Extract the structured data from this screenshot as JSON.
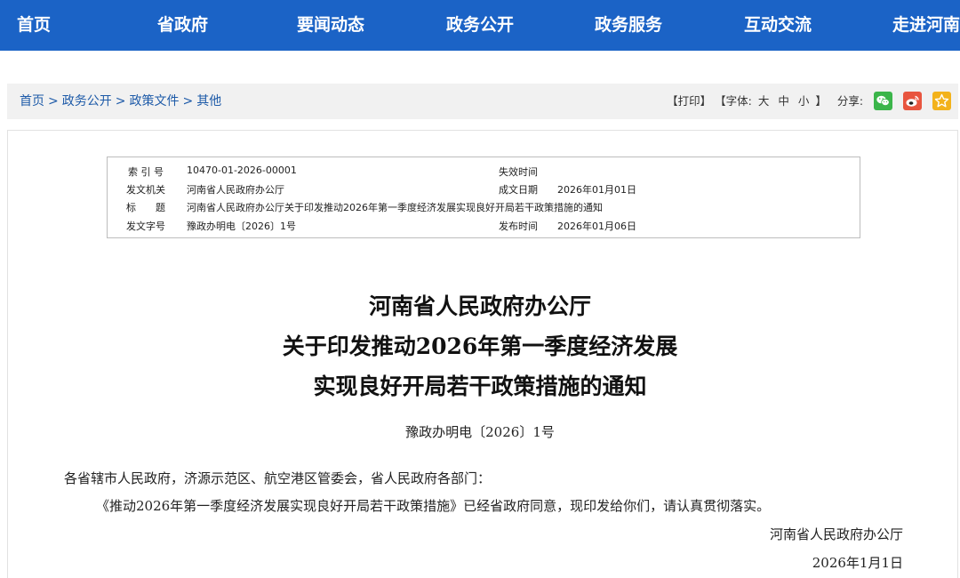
{
  "nav": {
    "items": [
      "首页",
      "省政府",
      "要闻动态",
      "政务公开",
      "政务服务",
      "互动交流",
      "走进河南"
    ]
  },
  "breadcrumb": {
    "items": [
      "首页",
      "政务公开",
      "政策文件",
      "其他"
    ],
    "separator": ">"
  },
  "tools": {
    "print": "【打印】",
    "font_label": "【字体:",
    "font_large": "大",
    "font_medium": "中",
    "font_small": "小",
    "font_close": "】",
    "share_label": "分享:",
    "share_icons": [
      "wechat-icon",
      "weibo-icon",
      "favorite-star-icon"
    ]
  },
  "meta": {
    "index_label": "索 引 号",
    "index_value": "10470-01-2026-00001",
    "expire_label": "失效时间",
    "expire_value": "",
    "issuer_label": "发文机关",
    "issuer_value": "河南省人民政府办公厅",
    "created_label": "成文日期",
    "created_value": "2026年01月01日",
    "title_label": "标　　题",
    "title_value": "河南省人民政府办公厅关于印发推动2026年第一季度经济发展实现良好开局若干政策措施的通知",
    "docno_label": "发文字号",
    "docno_value": "豫政办明电〔2026〕1号",
    "published_label": "发布时间",
    "published_value": "2026年01月06日"
  },
  "document": {
    "title_lines": [
      "河南省人民政府办公厅",
      "关于印发推动2026年第一季度经济发展",
      "实现良好开局若干政策措施的通知"
    ],
    "doc_number": "豫政办明电〔2026〕1号",
    "addressee": "各省辖市人民政府，济源示范区、航空港区管委会，省人民政府各部门：",
    "body": "《推动2026年第一季度经济发展实现良好开局若干政策措施》已经省政府同意，现印发给你们，请认真贯彻落实。",
    "signature": "河南省人民政府办公厅",
    "date": "2026年1月1日"
  },
  "colors": {
    "nav_bg": "#1b63c6",
    "crumb_link": "#1d5aa8",
    "wechat": "#3bb54a",
    "weibo": "#e8553f",
    "favorite": "#f3b21b"
  }
}
